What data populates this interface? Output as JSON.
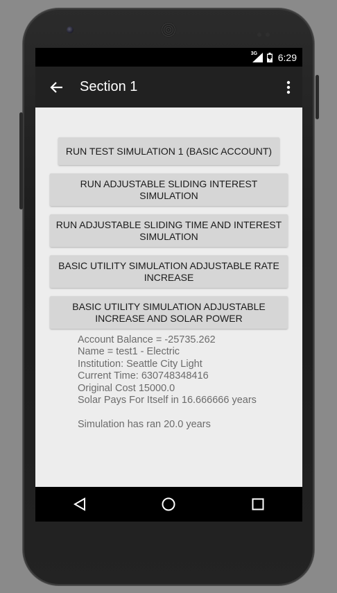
{
  "status_bar": {
    "network": "3G",
    "time": "6:29"
  },
  "app_bar": {
    "title": "Section 1",
    "back_icon": "arrow-left-icon",
    "menu_icon": "more-vertical-icon"
  },
  "buttons": [
    {
      "label": "RUN TEST SIMULATION 1 (BASIC ACCOUNT)"
    },
    {
      "label": "RUN ADJUSTABLE SLIDING INTEREST SIMULATION"
    },
    {
      "label": "RUN ADJUSTABLE SLIDING TIME AND INTEREST SIMULATION"
    },
    {
      "label": "BASIC UTILITY SIMULATION ADJUSTABLE RATE INCREASE"
    },
    {
      "label": "BASIC UTILITY SIMULATION ADJUSTABLE INCREASE AND SOLAR POWER"
    }
  ],
  "output": {
    "lines": [
      "Account Balance = -25735.262",
      "Name = test1 - Electric",
      "Institution: Seattle City Light",
      "Current Time: 630748348416",
      "Original Cost 15000.0",
      "Solar Pays For Itself in 16.666666 years",
      "",
      "Simulation has ran 20.0 years"
    ]
  },
  "nav_bar": {
    "back_icon": "nav-back-icon",
    "home_icon": "nav-home-icon",
    "recents_icon": "nav-recents-icon"
  },
  "colors": {
    "app_bar": "#212121",
    "content_bg": "#ededed",
    "button_bg": "#d6d6d6",
    "output_text": "#6b6b6b"
  }
}
